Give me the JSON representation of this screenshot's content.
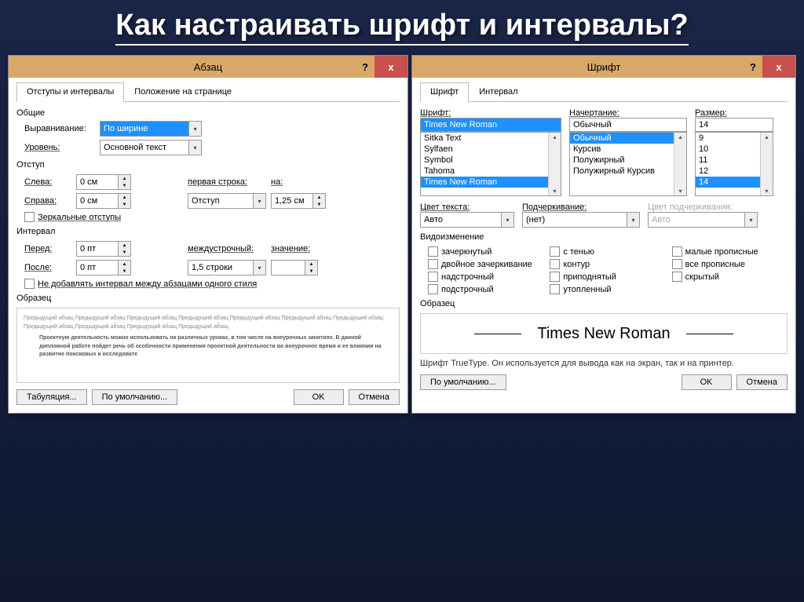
{
  "slide": {
    "title": "Как настраивать шрифт и интервалы?"
  },
  "paragraph": {
    "title": "Абзац",
    "help": "?",
    "close": "x",
    "tabs": {
      "t1": "Отступы и интервалы",
      "t2": "Положение на странице"
    },
    "common": {
      "header": "Общие",
      "align_label": "Выравнивание:",
      "align_value": "По ширине",
      "level_label": "Уровень:",
      "level_value": "Основной текст"
    },
    "indent": {
      "header": "Отступ",
      "left_label": "Слева:",
      "left_value": "0 см",
      "right_label": "Справа:",
      "right_value": "0 см",
      "first_label": "первая строка:",
      "first_value": "Отступ",
      "by_label": "на:",
      "by_value": "1,25 см",
      "mirror": "Зеркальные отступы"
    },
    "spacing": {
      "header": "Интервал",
      "before_label": "Перед:",
      "before_value": "0 пт",
      "after_label": "После:",
      "after_value": "0 пт",
      "line_label": "междустрочный:",
      "line_value": "1,5 строки",
      "val_label": "значение:",
      "nostyle": "Не добавлять интервал между абзацами одного стиля"
    },
    "sample": {
      "header": "Образец",
      "preview_lorem": "Предыдущий абзац Предыдущий абзац Предыдущий абзац Предыдущий абзац Предыдущий абзац Предыдущий абзац Предыдущий абзац Предыдущий абзац Предыдущий абзац Предыдущий абзац Предыдущий абзац",
      "preview_main": "Проектную деятельность можно использовать на различных уроках, в том числе на внеурочных занятиях. В данной дипломной работе пойдет речь об особенности применения проектной деятельности во внеурочное время и ее влиянии на развитие поисковых и исследовате"
    },
    "buttons": {
      "tabs": "Табуляция...",
      "default": "По умолчанию...",
      "ok": "OK",
      "cancel": "Отмена"
    }
  },
  "font": {
    "title": "Шрифт",
    "help": "?",
    "close": "x",
    "tabs": {
      "t1": "Шрифт",
      "t2": "Интервал"
    },
    "font_label": "Шрифт:",
    "font_value": "Times New Roman",
    "font_list": [
      "Sitka Text",
      "Sylfaen",
      "Symbol",
      "Tahoma",
      "Times New Roman"
    ],
    "style_label": "Начертание:",
    "style_value": "Обычный",
    "style_list": [
      "Обычный",
      "Курсив",
      "Полужирный",
      "Полужирный Курсив"
    ],
    "size_label": "Размер:",
    "size_value": "14",
    "size_list": [
      "9",
      "10",
      "11",
      "12",
      "14"
    ],
    "color_label": "Цвет текста:",
    "color_value": "Авто",
    "underline_label": "Подчеркивание:",
    "underline_value": "(нет)",
    "ucolor_label": "Цвет подчеркивания:",
    "ucolor_value": "Авто",
    "effects": {
      "header": "Видоизменение",
      "e1": "зачеркнутый",
      "e4": "с тенью",
      "e7": "малые прописные",
      "e2": "двойное зачеркивание",
      "e5": "контур",
      "e8": "все прописные",
      "e3": "надстрочный",
      "e6": "приподнятый",
      "e9": "скрытый",
      "e10": "подстрочный",
      "e11": "утопленный"
    },
    "sample_header": "Образец",
    "sample_text": "Times New Roman",
    "hint": "Шрифт TrueType. Он используется для вывода как на экран, так и на принтер.",
    "buttons": {
      "default": "По умолчанию...",
      "ok": "OK",
      "cancel": "Отмена"
    }
  }
}
